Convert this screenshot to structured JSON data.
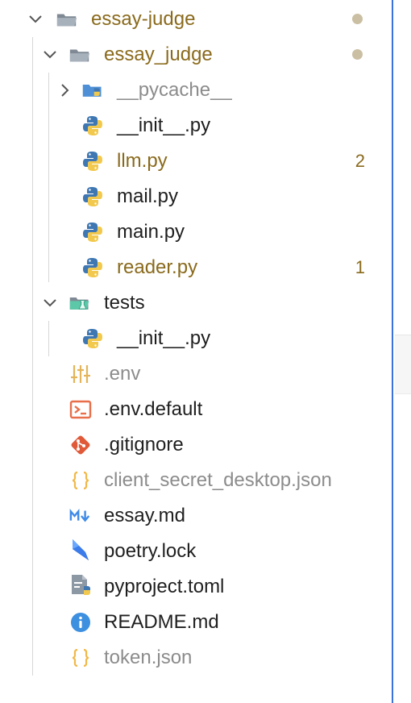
{
  "explorer": {
    "root": {
      "name": "essay-judge",
      "expanded": true,
      "status": "modified-dot"
    },
    "items": [
      {
        "label": "essay-judge",
        "icon": "folder-open-icon",
        "chevron": "down",
        "status": "modified",
        "dot": true
      },
      {
        "label": "essay_judge",
        "icon": "folder-open-icon",
        "chevron": "down",
        "status": "modified",
        "dot": true
      },
      {
        "label": "__pycache__",
        "icon": "python-folder-icon",
        "chevron": "right",
        "status": "ignored"
      },
      {
        "label": "__init__.py",
        "icon": "python-icon",
        "status": "normal"
      },
      {
        "label": "llm.py",
        "icon": "python-icon",
        "status": "modified",
        "badge": "2"
      },
      {
        "label": "mail.py",
        "icon": "python-icon",
        "status": "normal"
      },
      {
        "label": "main.py",
        "icon": "python-icon",
        "status": "normal"
      },
      {
        "label": "reader.py",
        "icon": "python-icon",
        "status": "modified",
        "badge": "1"
      },
      {
        "label": "tests",
        "icon": "test-folder-icon",
        "chevron": "down",
        "status": "normal"
      },
      {
        "label": "__init__.py",
        "icon": "python-icon",
        "status": "normal"
      },
      {
        "label": ".env",
        "icon": "env-settings-icon",
        "status": "ignored"
      },
      {
        "label": ".env.default",
        "icon": "terminal-icon",
        "status": "normal"
      },
      {
        "label": ".gitignore",
        "icon": "git-icon",
        "status": "normal"
      },
      {
        "label": "client_secret_desktop.json",
        "icon": "json-braces-icon",
        "status": "ignored"
      },
      {
        "label": "essay.md",
        "icon": "markdown-icon",
        "status": "normal"
      },
      {
        "label": "poetry.lock",
        "icon": "poetry-icon",
        "status": "normal"
      },
      {
        "label": "pyproject.toml",
        "icon": "python-config-icon",
        "status": "normal"
      },
      {
        "label": "README.md",
        "icon": "info-icon",
        "status": "normal"
      },
      {
        "label": "token.json",
        "icon": "json-braces-icon",
        "status": "ignored"
      }
    ]
  },
  "colors": {
    "modified": "#8a6a1c",
    "ignored": "#8c8c8c",
    "normal": "#1f1f1f",
    "focus_border": "#3b73d8",
    "python_blue": "#3f77b2",
    "python_yellow": "#f2c94c",
    "folder_gray": "#8d98a5",
    "test_green": "#3fbf9b",
    "terminal_orange": "#e86f4a",
    "git_red": "#e05a3a",
    "json_yellow": "#f1b84a",
    "markdown_blue": "#3f8be8",
    "poetry_blue": "#2a64d8",
    "info_blue": "#3d8fe0"
  }
}
